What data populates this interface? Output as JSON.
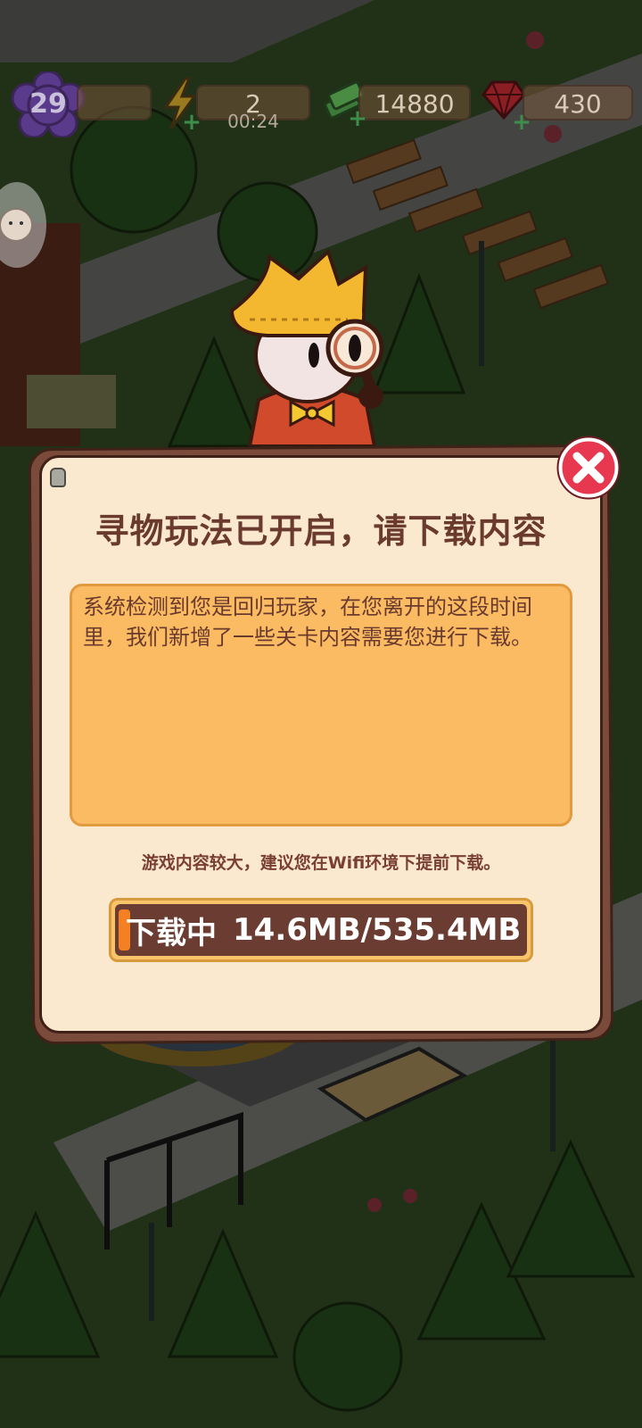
{
  "hud": {
    "level": "29",
    "energy": "2",
    "energy_timer": "00:24",
    "cash": "14880",
    "gems": "430",
    "plus_symbol": "+"
  },
  "dialog": {
    "title": "寻物玩法已开启，请下载内容",
    "message": "系统检测到您是回归玩家，在您离开的这段时间里，我们新增了一些关卡内容需要您进行下载。",
    "hint": "游戏内容较大，建议您在Wifi环境下提前下载。",
    "download": {
      "status": "下载中",
      "progress_text": "14.6MB/535.4MB",
      "downloaded_mb": 14.6,
      "total_mb": 535.4
    }
  },
  "icons": {
    "level": "flower-badge-icon",
    "energy": "lightning-bolt-icon",
    "cash": "cash-stack-icon",
    "gems": "red-gem-icon",
    "close": "close-x-icon"
  },
  "colors": {
    "dialog_border": "#7a4a3a",
    "dialog_paper": "#fbe9cf",
    "message_box": "#fbbb62",
    "title_text": "#6a3a2e",
    "progress_fill": "#f57f23",
    "close_button": "#e8384f"
  }
}
